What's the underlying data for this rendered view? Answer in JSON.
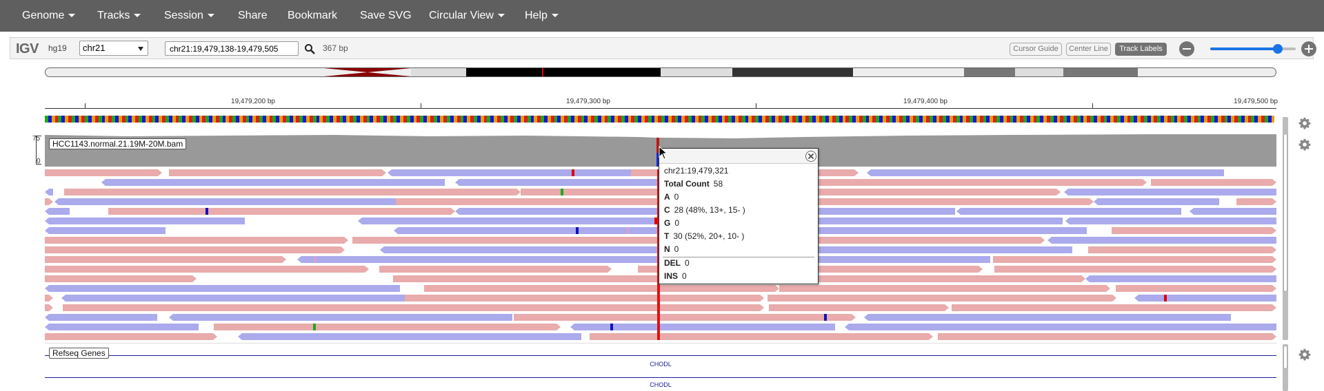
{
  "navbar": {
    "items": [
      {
        "label": "Genome",
        "dropdown": true
      },
      {
        "label": "Tracks",
        "dropdown": true
      },
      {
        "label": "Session",
        "dropdown": true
      },
      {
        "label": "Share",
        "dropdown": false
      },
      {
        "label": "Bookmark",
        "dropdown": false
      },
      {
        "label": "Save SVG",
        "dropdown": false
      },
      {
        "label": "Circular View",
        "dropdown": true
      },
      {
        "label": "Help",
        "dropdown": true
      }
    ]
  },
  "header": {
    "logo": "IGV",
    "genome": "hg19",
    "chromosome": "chr21",
    "locus": "chr21:19,479,138-19,479,505",
    "width_label": "367 bp",
    "buttons": {
      "cursor_guide": "Cursor Guide",
      "center_line": "Center Line",
      "track_labels": "Track Labels"
    },
    "zoom_level": 0.78
  },
  "ruler": {
    "labels": [
      "19,479,200 bp",
      "19,479,300 bp",
      "19,479,400 bp",
      "19,479,500 bp"
    ]
  },
  "tracks": {
    "alignment": {
      "name": "HCC1143.normal.21.19M-20M.bam",
      "cov_max": "75",
      "cov_min": "0"
    },
    "genes": {
      "name": "Refseq Genes",
      "gene_label_1": "CHODL",
      "gene_label_2": "CHODL"
    }
  },
  "popup": {
    "position": "chr21:19,479,321",
    "total_label": "Total Count",
    "total_value": "58",
    "a_label": "A",
    "a_value": "0",
    "c_label": "C",
    "c_value": "28 (48%, 13+, 15- )",
    "g_label": "G",
    "g_value": "0",
    "t_label": "T",
    "t_value": "30 (52%, 20+, 10- )",
    "n_label": "N",
    "n_value": "0",
    "del_label": "DEL",
    "del_value": "0",
    "ins_label": "INS",
    "ins_value": "0"
  },
  "colors": {
    "navbar": "#5f5f5f",
    "forward_read": "#e9abab",
    "reverse_read": "#aaaaec",
    "coverage": "#999999",
    "snp_highlight": "#e01010",
    "gene": "#1a1aa0",
    "accent": "#1a73e8"
  }
}
